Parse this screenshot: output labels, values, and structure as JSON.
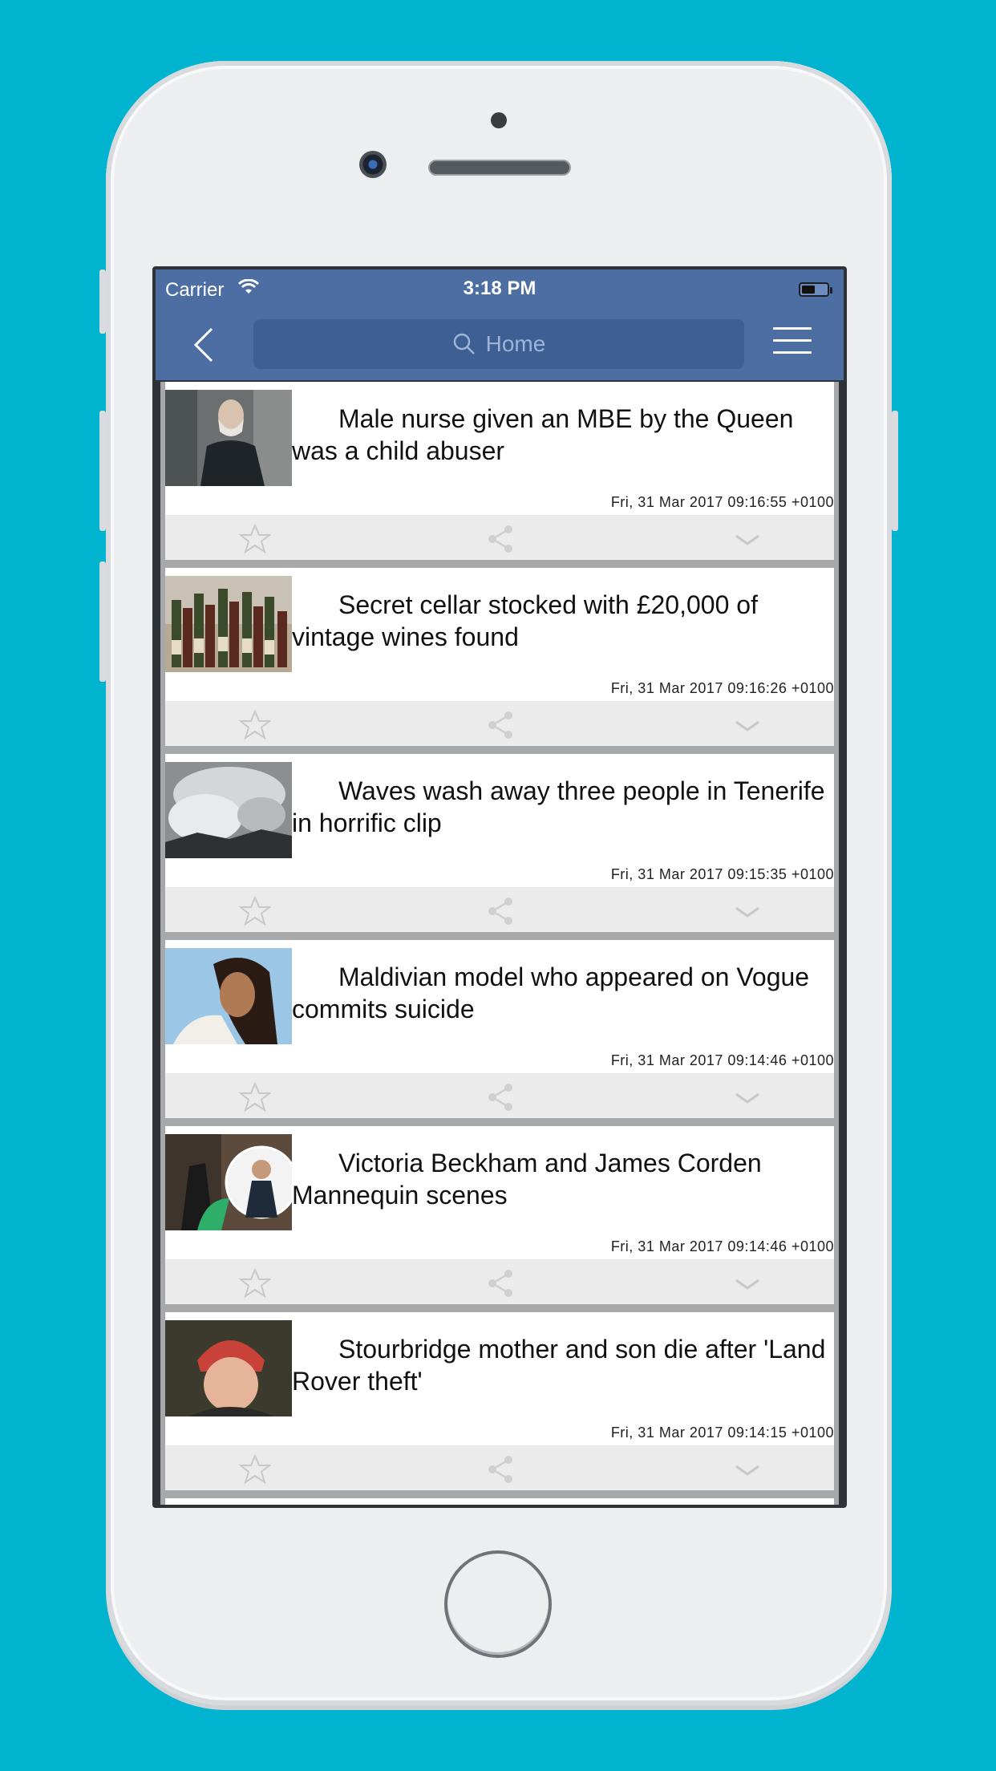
{
  "status_bar": {
    "carrier": "Carrier",
    "time": "3:18 PM"
  },
  "nav": {
    "search_placeholder": "Home"
  },
  "articles": [
    {
      "title": "Male nurse given an MBE by the Queen was a child abuser",
      "date": "Fri, 31 Mar 2017 09:16:55 +0100"
    },
    {
      "title": "Secret cellar stocked with £20,000 of vintage wines found",
      "date": "Fri, 31 Mar 2017 09:16:26 +0100"
    },
    {
      "title": "Waves wash away three people in Tenerife in horrific clip",
      "date": "Fri, 31 Mar 2017 09:15:35 +0100"
    },
    {
      "title": "Maldivian model who appeared on Vogue commits suicide",
      "date": "Fri, 31 Mar 2017 09:14:46 +0100"
    },
    {
      "title": "Victoria Beckham and James Corden Mannequin scenes",
      "date": "Fri, 31 Mar 2017 09:14:46 +0100"
    },
    {
      "title": "Stourbridge mother and son die after 'Land Rover theft'",
      "date": "Fri, 31 Mar 2017 09:14:15 +0100"
    }
  ],
  "colors": {
    "background": "#00B4CF",
    "navbar": "#4c6ea2",
    "search_field": "#3e5f93"
  }
}
